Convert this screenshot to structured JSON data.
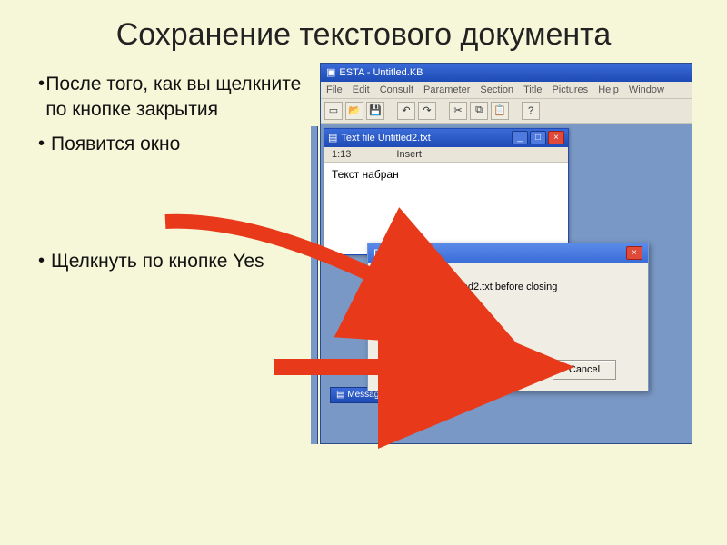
{
  "slide": {
    "title": "Сохранение текстового документа",
    "bullets": [
      "После того, как вы щелкните по кнопке закрытия",
      "Появится окно",
      "Щелкнуть по кнопке Yes"
    ]
  },
  "esta_main": {
    "title": "ESTA - Untitled.KB",
    "menu": [
      "File",
      "Edit",
      "Consult",
      "Parameter",
      "Section",
      "Title",
      "Pictures",
      "Help",
      "Window"
    ],
    "toolbar_icons": [
      "new",
      "open",
      "save",
      "|",
      "undo",
      "redo",
      "|",
      "cut",
      "copy",
      "paste",
      "|",
      "help"
    ]
  },
  "text_window": {
    "title": "Text file Untitled2.txt",
    "status_pos": "1:13",
    "status_mode": "Insert",
    "content": "Текст набран"
  },
  "dialog": {
    "title": "ESTA",
    "message": "Update untitled2.txt before closing",
    "buttons": {
      "yes": "Yes",
      "no": "No",
      "cancel": "Cancel"
    }
  },
  "taskbar_item": "Messages"
}
